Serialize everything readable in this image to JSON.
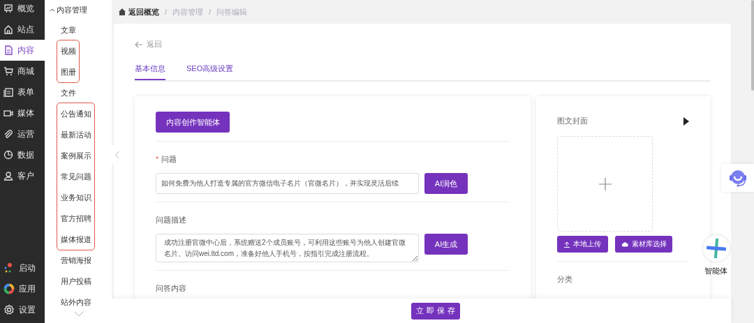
{
  "rail": {
    "items": [
      {
        "label": "概览",
        "selected": false
      },
      {
        "label": "站点",
        "selected": false
      },
      {
        "label": "内容",
        "selected": true
      },
      {
        "label": "商城",
        "selected": false
      },
      {
        "label": "表单",
        "selected": false
      },
      {
        "label": "媒体",
        "selected": false
      },
      {
        "label": "运营",
        "selected": false
      },
      {
        "label": "数据",
        "selected": false
      },
      {
        "label": "客户",
        "selected": false
      }
    ],
    "bottom_items": [
      {
        "label": "启动"
      },
      {
        "label": "应用"
      },
      {
        "label": "设置"
      }
    ]
  },
  "submenu": {
    "title": "内容管理",
    "expanded": true,
    "groups": [
      {
        "highlighted": false,
        "items": [
          "文章"
        ]
      },
      {
        "highlighted": true,
        "items": [
          "视频",
          "图册"
        ]
      },
      {
        "highlighted": false,
        "items": [
          "文件"
        ]
      },
      {
        "highlighted": true,
        "items": [
          "公告通知",
          "最新活动",
          "案例展示",
          "常见问题",
          "业务知识",
          "官方招聘",
          "媒体报道"
        ]
      },
      {
        "highlighted": false,
        "items": [
          "营销海报",
          "用户投稿",
          "站外内容"
        ]
      }
    ]
  },
  "breadcrumb": [
    {
      "label": "返回概览"
    },
    {
      "separator": "/",
      "label": "内容管理"
    },
    {
      "separator": "/",
      "label": "问答编辑"
    }
  ],
  "back_link": "返回",
  "tabs": [
    {
      "label": "基本信息",
      "selected": true
    },
    {
      "label": "SEO高级设置",
      "selected": false
    }
  ],
  "agent_button": "内容创作智能体",
  "fields": [
    {
      "kind": "input",
      "label": "问题",
      "required_mark": "*",
      "value": "如何免费为他人打造专属的官方微信电子名片（官微名片），并实现灵活后续",
      "action": "AI润色"
    },
    {
      "kind": "textarea",
      "label": "问题描述",
      "value": "成功注册官微中心后，系统赠送2个成员账号，可利用这些账号为他人创建官微名片。访问wei.ltd.com，准备好他人手机号，按指引完成注册流程。",
      "action": "AI生成"
    },
    {
      "kind": "label",
      "label": "问答内容"
    }
  ],
  "cover": {
    "label": "图文封面",
    "upload_button": "本地上传",
    "library_button": "素材库选择"
  },
  "category_label": "分类",
  "save_button": "立即保存",
  "assistant": {
    "label": "智能体"
  }
}
